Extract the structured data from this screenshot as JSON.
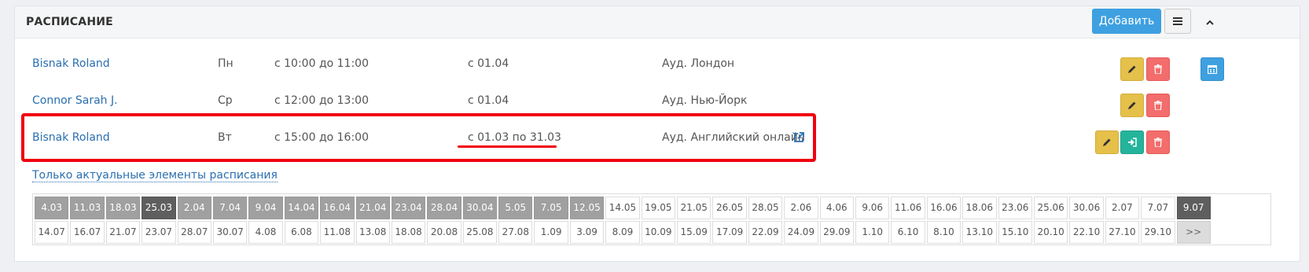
{
  "panel": {
    "title": "РАСПИСАНИЕ",
    "add_label": "Добавить",
    "menu_icon": "hamburger-icon",
    "collapse_icon": "chevron-up-icon"
  },
  "rows": [
    {
      "teacher": "Bisnak Roland",
      "day": "Пн",
      "time": "с 10:00 до 11:00",
      "period": "с 01.04",
      "room": "Ауд. Лондон"
    },
    {
      "teacher": "Connor Sarah J.",
      "day": "Ср",
      "time": "с 12:00 до 13:00",
      "period": "с 01.04",
      "room": "Ауд. Нью-Йорк"
    },
    {
      "teacher": "Bisnak Roland",
      "day": "Вт",
      "time": "с 15:00 до 16:00",
      "period": "с 01.03 по 31.03",
      "room": "Ауд. Английский онлайн"
    }
  ],
  "actual_link": "Только актуальные элементы расписания",
  "dates_row1": [
    "4.03",
    "11.03",
    "18.03",
    "25.03",
    "2.04",
    "7.04",
    "9.04",
    "14.04",
    "16.04",
    "21.04",
    "23.04",
    "28.04",
    "30.04",
    "5.05",
    "7.05",
    "12.05",
    "14.05",
    "19.05",
    "21.05",
    "26.05",
    "28.05",
    "2.06",
    "4.06",
    "9.06",
    "11.06",
    "16.06",
    "18.06",
    "23.06",
    "25.06",
    "30.06",
    "2.07",
    "7.07",
    "9.07"
  ],
  "dates_row2": [
    "14.07",
    "16.07",
    "21.07",
    "23.07",
    "28.07",
    "30.07",
    "4.08",
    "6.08",
    "11.08",
    "13.08",
    "18.08",
    "20.08",
    "25.08",
    "27.08",
    "1.09",
    "3.09",
    "8.09",
    "10.09",
    "15.09",
    "17.09",
    "22.09",
    "24.09",
    "29.09",
    "1.10",
    "6.10",
    "8.10",
    "13.10",
    "15.10",
    "20.10",
    "22.10",
    "27.10",
    "29.10",
    ">>"
  ],
  "colors": {
    "accent": "#3ea0e0",
    "edit": "#e5c04a",
    "delete": "#f26d6b",
    "enter": "#24b39b",
    "highlight": "#f0000e"
  }
}
